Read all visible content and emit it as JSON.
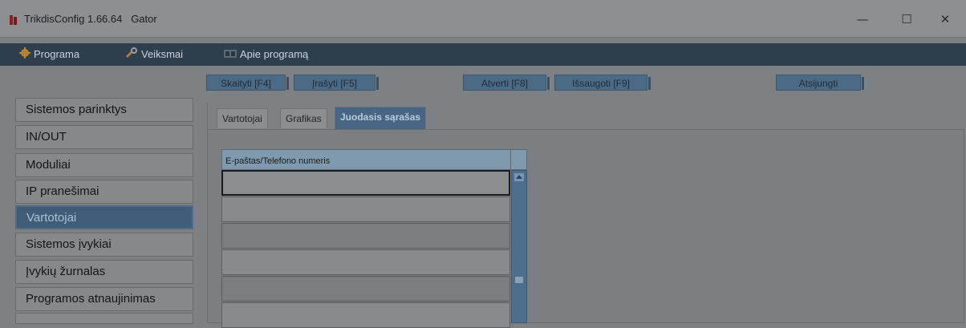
{
  "window": {
    "title": "TrikdisConfig 1.66.64   Gator",
    "minimize": "—",
    "maximize": "☐",
    "close": "✕"
  },
  "menu": {
    "items": [
      {
        "label": "Programa",
        "icon": "gear-icon"
      },
      {
        "label": "Veiksmai",
        "icon": "wrench-icon"
      },
      {
        "label": "Apie programą",
        "icon": "book-icon"
      }
    ]
  },
  "toolbar": {
    "read": "Skaityti [F4]",
    "write": "Įrašyti [F5]",
    "open": "Atverti [F8]",
    "save": "Išsaugoti [F9]",
    "disconnect": "Atsijungti"
  },
  "sidebar": {
    "items": [
      {
        "label": "Sistemos parinktys"
      },
      {
        "label": "IN/OUT"
      },
      {
        "label": "Moduliai"
      },
      {
        "label": "IP pranešimai"
      },
      {
        "label": "Vartotojai"
      },
      {
        "label": "Sistemos įvykiai"
      },
      {
        "label": "Įvykių žurnalas"
      },
      {
        "label": "Programos atnaujinimas"
      }
    ],
    "active_index": 4
  },
  "tabs": {
    "items": [
      {
        "label": "Vartotojai"
      },
      {
        "label": "Grafikas"
      },
      {
        "label": "Juodasis sąrašas"
      }
    ],
    "active_index": 2
  },
  "table": {
    "column": "E-paštas/Telefono numeris",
    "rows": [
      "",
      "",
      "",
      "",
      "",
      ""
    ]
  },
  "colors": {
    "accent": "#466683",
    "menubar": "#2f3e4c"
  }
}
